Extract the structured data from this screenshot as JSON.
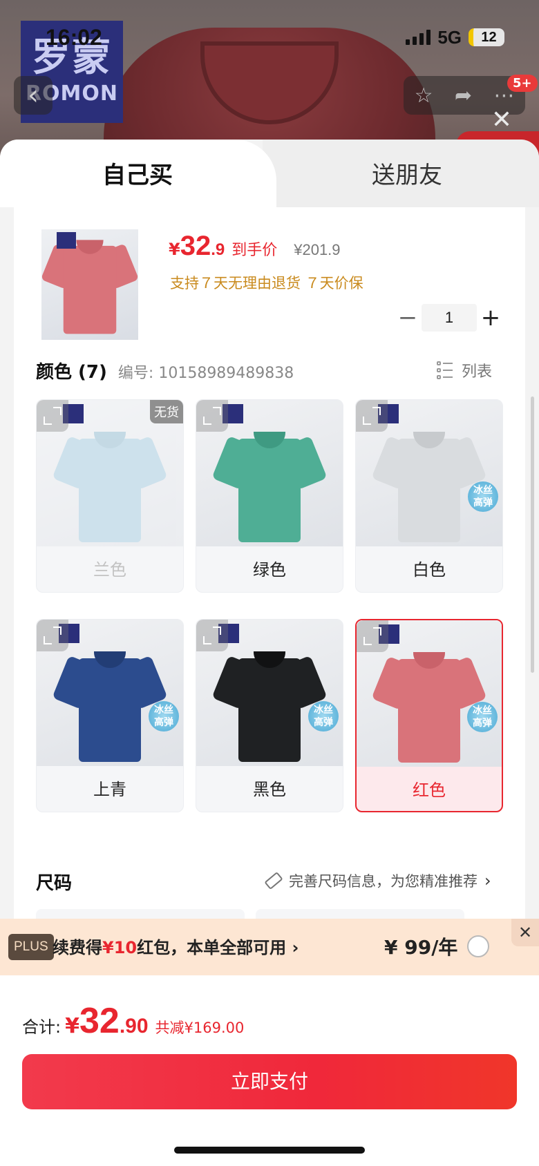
{
  "status_bar": {
    "time": "16:02",
    "network": "5G",
    "battery": "12"
  },
  "background": {
    "brand_cn": "罗蒙",
    "brand_en": "ROMON",
    "badge": "5+"
  },
  "tabs": [
    {
      "label": "自己买",
      "active": true
    },
    {
      "label": "送朋友",
      "active": false
    }
  ],
  "product": {
    "price_symbol": "¥",
    "price_int": "32",
    "price_dec": ".9",
    "price_label": "到手价",
    "original_price": "¥201.9",
    "policy": "支持７天无理由退货  ７天价保",
    "quantity": "1"
  },
  "color_section": {
    "title": "颜色 (7)",
    "code": "编号: 10158989489838",
    "list_toggle": "列表",
    "variants": [
      {
        "label": "兰色",
        "color": "#9ec9de",
        "out_of_stock": "无货",
        "state": "disabled"
      },
      {
        "label": "绿色",
        "color": "#4fae95",
        "state": "normal"
      },
      {
        "label": "白色",
        "color": "#d9dcdf",
        "state": "normal"
      },
      {
        "label": "上青",
        "color": "#2c4c8e",
        "state": "normal"
      },
      {
        "label": "黑色",
        "color": "#1f2123",
        "state": "normal"
      },
      {
        "label": "红色",
        "color": "#d9737a",
        "state": "selected"
      }
    ]
  },
  "size_section": {
    "title": "尺码",
    "hint": "完善尺码信息，为您精准推荐"
  },
  "plus_banner": {
    "tag": "PLUS",
    "text_a": "续费得",
    "text_highlight": "¥10",
    "text_b": "红包，本单全部可用",
    "chevron": "›",
    "price": "¥ 99/年",
    "close": "✕"
  },
  "footer": {
    "total_label": "合计:",
    "total_symbol": "¥",
    "total_int": "32",
    "total_dec": ".90",
    "savings": "共减¥169.00",
    "pay_button": "立即支付"
  },
  "colors": {
    "accent": "#e8262f",
    "policy": "#c98a1d",
    "plus_bg": "#fde6d3"
  }
}
